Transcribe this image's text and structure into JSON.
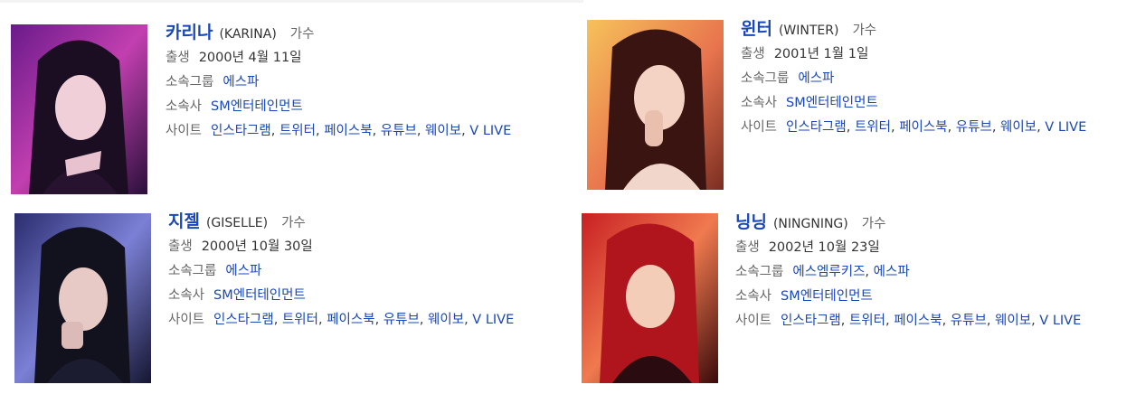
{
  "labels": {
    "birth": "출생",
    "group": "소속그룹",
    "agency": "소속사",
    "site": "사이트"
  },
  "members": [
    {
      "name": "카리나",
      "alias": "(KARINA)",
      "job": "가수",
      "birth": "2000년 4월 11일",
      "groups": [
        "에스파"
      ],
      "agency": "SM엔터테인먼트",
      "sites": [
        "인스타그램",
        "트위터",
        "페이스북",
        "유튜브",
        "웨이보",
        "V LIVE"
      ],
      "photo": {
        "description": "karina-portrait",
        "colors": [
          "#2a0f3a",
          "#b03aa8",
          "#f2b7d8"
        ]
      }
    },
    {
      "name": "윈터",
      "alias": "(WINTER)",
      "job": "가수",
      "birth": "2001년 1월 1일",
      "groups": [
        "에스파"
      ],
      "agency": "SM엔터테인먼트",
      "sites": [
        "인스타그램",
        "트위터",
        "페이스북",
        "유튜브",
        "웨이보",
        "V LIVE"
      ],
      "photo": {
        "description": "winter-portrait",
        "colors": [
          "#f2a14a",
          "#e86a55",
          "#6b2a1e"
        ]
      }
    },
    {
      "name": "지젤",
      "alias": "(GISELLE)",
      "job": "가수",
      "birth": "2000년 10월 30일",
      "groups": [
        "에스파"
      ],
      "agency": "SM엔터테인먼트",
      "sites": [
        "인스타그램",
        "트위터",
        "페이스북",
        "유튜브",
        "웨이보",
        "V LIVE"
      ],
      "photo": {
        "description": "giselle-portrait",
        "colors": [
          "#1c1d4a",
          "#6a7ad8",
          "#b7a4e0"
        ]
      }
    },
    {
      "name": "닝닝",
      "alias": "(NINGNING)",
      "job": "가수",
      "birth": "2002년 10월 23일",
      "groups": [
        "에스엠루키즈",
        "에스파"
      ],
      "agency": "SM엔터테인먼트",
      "sites": [
        "인스타그램",
        "트위터",
        "페이스북",
        "유튜브",
        "웨이보",
        "V LIVE"
      ],
      "photo": {
        "description": "ningning-portrait",
        "colors": [
          "#3b0a0a",
          "#d8262b",
          "#f28a5a"
        ]
      }
    }
  ]
}
